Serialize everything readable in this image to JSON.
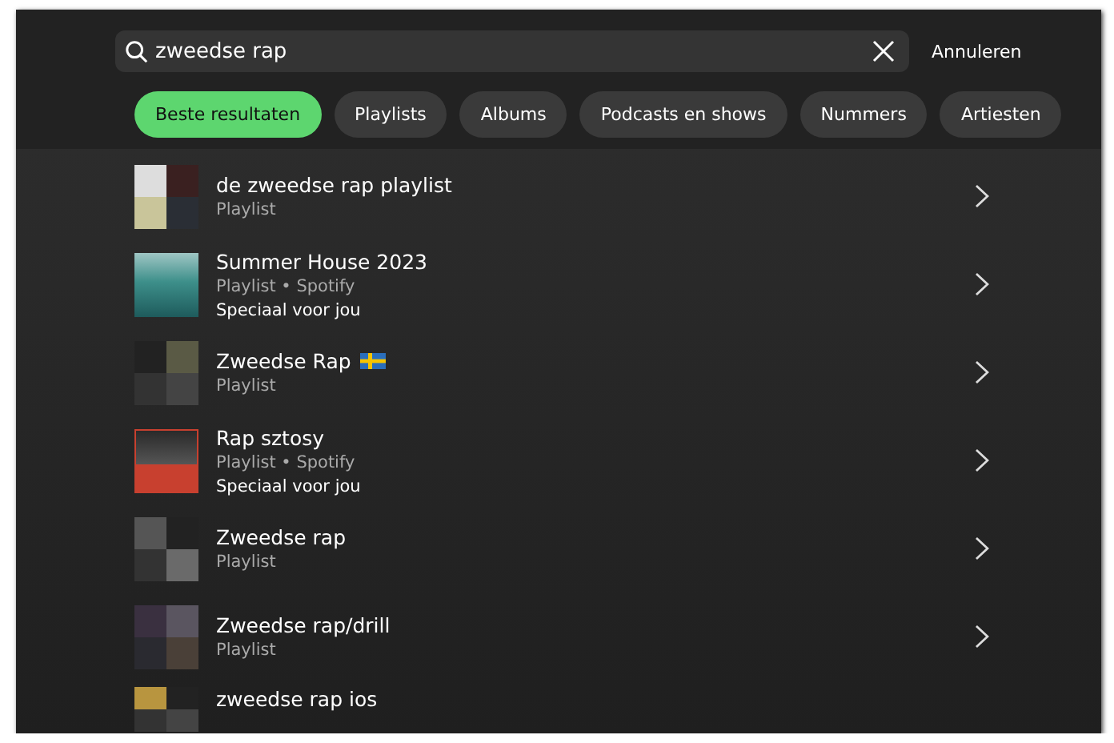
{
  "search": {
    "value": "zweedse rap",
    "cancel": "Annuleren"
  },
  "filters": [
    {
      "label": "Beste resultaten",
      "selected": true
    },
    {
      "label": "Playlists",
      "selected": false
    },
    {
      "label": "Albums",
      "selected": false
    },
    {
      "label": "Podcasts en shows",
      "selected": false
    },
    {
      "label": "Nummers",
      "selected": false
    },
    {
      "label": "Artiesten",
      "selected": false
    }
  ],
  "results": [
    {
      "title": "de zweedse rap playlist",
      "subtitle": "Playlist",
      "flag": false
    },
    {
      "title": "Summer House 2023",
      "subtitle": "Playlist • Spotify",
      "note": "Speciaal voor jou",
      "flag": false
    },
    {
      "title": "Zweedse Rap",
      "subtitle": "Playlist",
      "flag": true
    },
    {
      "title": "Rap sztosy",
      "subtitle": "Playlist • Spotify",
      "note": "Speciaal voor jou",
      "flag": false
    },
    {
      "title": "Zweedse rap",
      "subtitle": "Playlist",
      "flag": false
    },
    {
      "title": "Zweedse rap/drill",
      "subtitle": "Playlist",
      "flag": false
    },
    {
      "title": "zweedse rap ios",
      "flag": false
    }
  ]
}
